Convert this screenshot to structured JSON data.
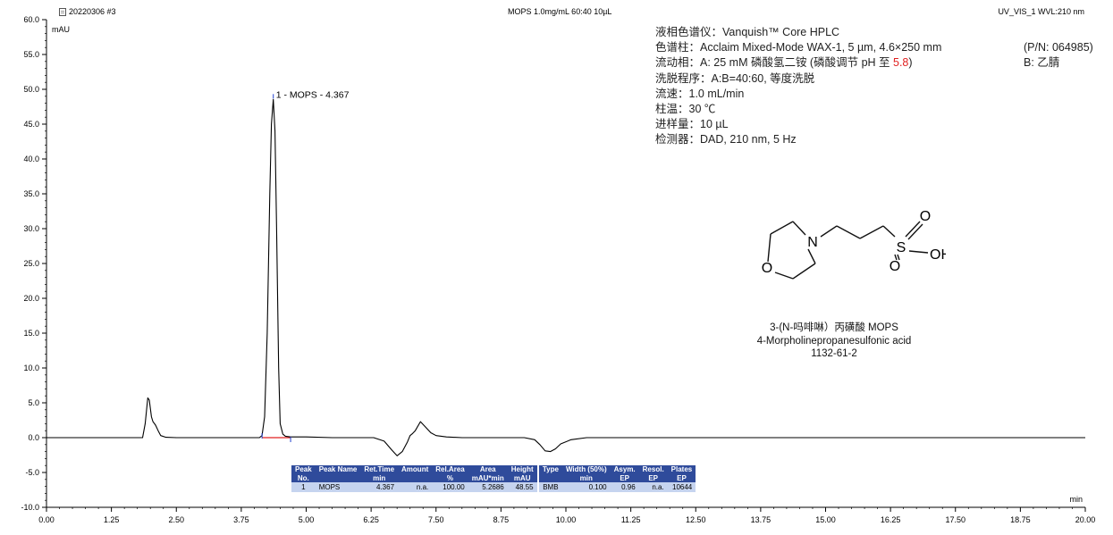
{
  "header": {
    "left": "20220306 #3",
    "center": "MOPS 1.0mg/mL 60:40 10µL",
    "right": "UV_VIS_1 WVL:210 nm"
  },
  "info": {
    "instrument": "液相色谱仪：Vanquish™ Core HPLC",
    "column": "色谱柱：Acclaim Mixed-Mode WAX-1, 5 µm, 4.6×250 mm",
    "column_pn": "(P/N: 064985)",
    "mobile_phase_a_prefix": "流动相：A: 25 mM 磷酸氢二铵 (磷酸调节 pH 至 ",
    "mobile_phase_a_ph": "5.8",
    "mobile_phase_a_suffix": ")",
    "mobile_phase_b": "B: 乙腈",
    "elution": "洗脱程序：A:B=40:60, 等度洗脱",
    "flow": "流速：1.0 mL/min",
    "temperature": "柱温：30 ℃",
    "injection": "进样量：10 µL",
    "detector": "检测器：DAD, 210 nm, 5 Hz"
  },
  "compound": {
    "name_cn": "3-(N-吗啡啉）丙磺酸 MOPS",
    "name_en": "4-Morpholinepropanesulfonic acid",
    "cas": "1132-61-2",
    "atoms": {
      "n": "N",
      "o_ring": "O",
      "s": "S",
      "o_top": "O",
      "o_bottom": "O",
      "oh": "OH"
    }
  },
  "results_table": {
    "headers": [
      [
        "Peak",
        "No."
      ],
      [
        "Peak Name",
        ""
      ],
      [
        "Ret.Time",
        "min"
      ],
      [
        "Amount",
        ""
      ],
      [
        "Rel.Area",
        "%"
      ],
      [
        "Area",
        "mAU*min"
      ],
      [
        "Height",
        "mAU"
      ],
      [
        "",
        ""
      ],
      [
        "Type",
        ""
      ],
      [
        "Width (50%)",
        "min"
      ],
      [
        "Asym.",
        "EP"
      ],
      [
        "Resol.",
        "EP"
      ],
      [
        "Plates",
        "EP"
      ]
    ],
    "rows": [
      [
        "1",
        "MOPS",
        "4.367",
        "n.a.",
        "100.00",
        "5.2686",
        "48.55",
        "",
        "BMB",
        "0.100",
        "0.96",
        "n.a.",
        "10644"
      ]
    ]
  },
  "chart_data": {
    "type": "line",
    "title": "MOPS 1.0mg/mL 60:40 10µL",
    "xlabel": "min",
    "ylabel": "mAU",
    "xlim": [
      0.0,
      20.0
    ],
    "ylim": [
      -10.0,
      60.0
    ],
    "x_ticks": [
      "0.00",
      "1.25",
      "2.50",
      "3.75",
      "5.00",
      "6.25",
      "7.50",
      "8.75",
      "10.00",
      "11.25",
      "12.50",
      "13.75",
      "15.00",
      "16.25",
      "17.50",
      "18.75",
      "20.00"
    ],
    "y_ticks": [
      "-10.0",
      "-5.0",
      "0.0",
      "5.0",
      "10.0",
      "15.0",
      "20.0",
      "25.0",
      "30.0",
      "35.0",
      "40.0",
      "45.0",
      "50.0",
      "55.0",
      "60.0"
    ],
    "series": [
      {
        "color": "#000000",
        "x": [
          0.0,
          1.0,
          1.85,
          1.9,
          1.95,
          1.98,
          2.02,
          2.05,
          2.1,
          2.15,
          2.2,
          2.3,
          2.5,
          3.0,
          3.5,
          4.0,
          4.1,
          4.15,
          4.2,
          4.25,
          4.3,
          4.33,
          4.367,
          4.4,
          4.43,
          4.47,
          4.5,
          4.55,
          4.6,
          4.7,
          5.0,
          5.5,
          6.0,
          6.3,
          6.5,
          6.65,
          6.75,
          6.85,
          6.95,
          7.0,
          7.05,
          7.1,
          7.2,
          7.3,
          7.4,
          7.5,
          7.7,
          8.0,
          8.5,
          9.0,
          9.2,
          9.4,
          9.5,
          9.6,
          9.7,
          9.8,
          9.9,
          10.1,
          10.4,
          10.8,
          11.25,
          12.0,
          13.0,
          14.0,
          15.0,
          16.0,
          17.0,
          18.0,
          19.0,
          20.0
        ],
        "y": [
          0.0,
          0.0,
          0.0,
          2.0,
          5.7,
          5.4,
          3.0,
          2.3,
          1.8,
          1.0,
          0.3,
          0.05,
          0.0,
          0.0,
          0.0,
          0.0,
          0.0,
          0.3,
          3.0,
          15.0,
          35.0,
          45.0,
          48.55,
          44.0,
          30.0,
          10.0,
          2.0,
          0.5,
          0.2,
          0.1,
          0.1,
          0.0,
          0.0,
          0.0,
          -0.5,
          -1.8,
          -2.6,
          -2.0,
          -0.6,
          0.3,
          0.6,
          1.0,
          2.3,
          1.5,
          0.7,
          0.3,
          0.1,
          0.0,
          0.0,
          0.0,
          0.0,
          -0.3,
          -1.0,
          -1.9,
          -2.0,
          -1.6,
          -0.9,
          -0.3,
          0.0,
          0.0,
          0.0,
          0.0,
          0.0,
          0.0,
          0.0,
          0.0,
          0.0,
          0.0,
          0.0,
          0.0
        ]
      }
    ],
    "peaks": [
      {
        "x": 4.367,
        "y": 48.55,
        "label": "1 - MOPS - 4.367"
      }
    ],
    "integration": {
      "start": 4.15,
      "end": 4.7,
      "color": "#e02020"
    },
    "colors": {
      "axis": "#000000",
      "marker": "#2040d0",
      "table_header": "#2f4b9b",
      "table_row": "#c6d4ef"
    }
  }
}
